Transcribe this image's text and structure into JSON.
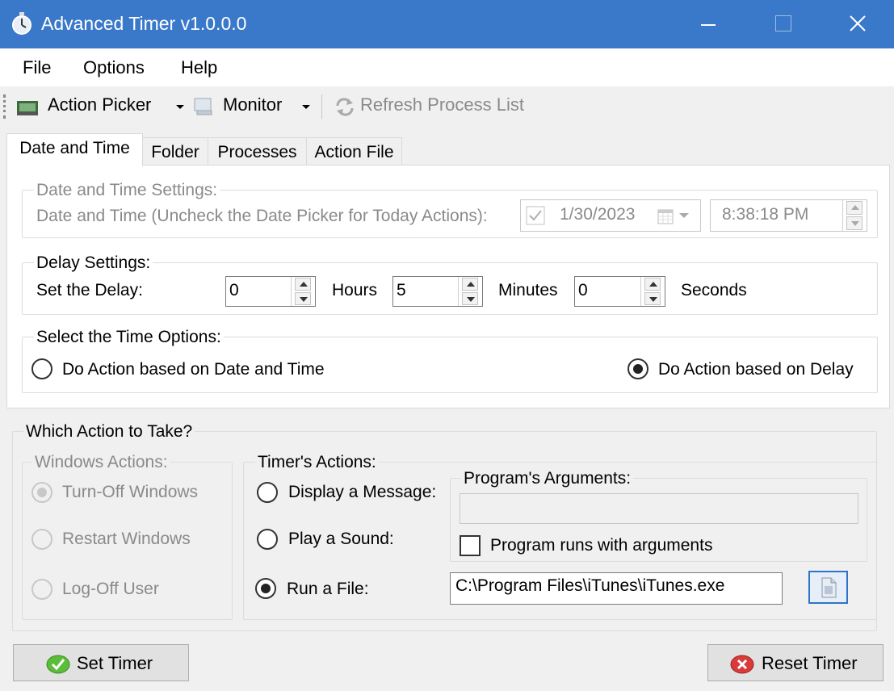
{
  "window": {
    "title": "Advanced Timer v1.0.0.0"
  },
  "menu": [
    "File",
    "Options",
    "Help"
  ],
  "toolbar": {
    "action_picker": "Action Picker",
    "monitor": "Monitor",
    "refresh": "Refresh Process List"
  },
  "tabs": [
    "Date and Time",
    "Folder",
    "Processes",
    "Action File"
  ],
  "date_time_settings": {
    "legend": "Date and Time Settings:",
    "label": "Date and Time (Uncheck the Date Picker for Today Actions):",
    "date": "1/30/2023",
    "time": "8:38:18 PM"
  },
  "delay_settings": {
    "legend": "Delay Settings:",
    "label": "Set the Delay:",
    "hours_value": "0",
    "hours_label": "Hours",
    "minutes_value": "5",
    "minutes_label": "Minutes",
    "seconds_value": "0",
    "seconds_label": "Seconds"
  },
  "time_options": {
    "legend": "Select the Time Options:",
    "option_datetime": "Do Action based on Date and Time",
    "option_delay": "Do Action based on Delay"
  },
  "action_group": {
    "legend": "Which Action to Take?",
    "windows_actions": {
      "legend": "Windows Actions:",
      "turn_off": "Turn-Off Windows",
      "restart": "Restart Windows",
      "log_off": "Log-Off User"
    },
    "timer_actions": {
      "legend": "Timer's Actions:",
      "display_message": "Display a Message:",
      "play_sound": "Play a Sound:",
      "run_file": "Run a File:",
      "file_path": "C:\\Program Files\\iTunes\\iTunes.exe"
    },
    "program_arguments": {
      "legend": "Program's Arguments:",
      "value": "",
      "checkbox_label": "Program runs with arguments"
    }
  },
  "buttons": {
    "set_timer": "Set Timer",
    "reset_timer": "Reset Timer"
  }
}
